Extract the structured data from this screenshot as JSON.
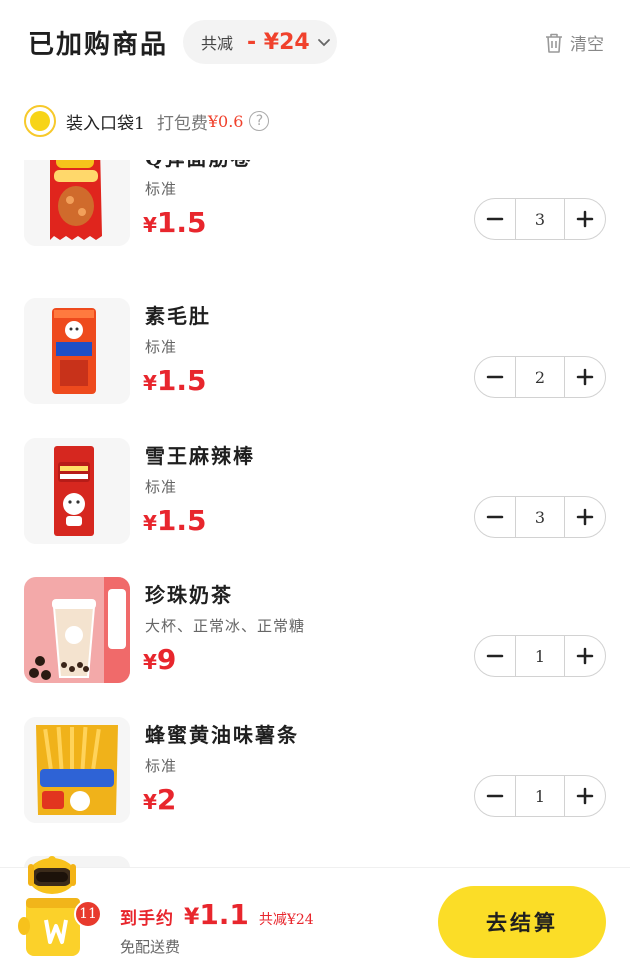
{
  "header": {
    "title": "已加购商品",
    "discount_label": "共减",
    "discount_value": "- ¥24",
    "clear_label": "清空"
  },
  "bag": {
    "label": "装入口袋1",
    "packing_label": "打包费",
    "packing_fee": "¥0.6"
  },
  "items": [
    {
      "name": "Q弹面筋卷",
      "spec": "标准",
      "price_symbol": "¥",
      "price": "1.5",
      "qty": "3",
      "image": "spicy-gluten-roll-pack"
    },
    {
      "name": "素毛肚",
      "spec": "标准",
      "price_symbol": "¥",
      "price": "1.5",
      "qty": "2",
      "image": "veggie-tripe-pack"
    },
    {
      "name": "雪王麻辣棒",
      "spec": "标准",
      "price_symbol": "¥",
      "price": "1.5",
      "qty": "3",
      "image": "spicy-stick-pack"
    },
    {
      "name": "珍珠奶茶",
      "spec": "大杯、正常冰、正常糖",
      "price_symbol": "¥",
      "price": "9",
      "qty": "1",
      "image": "pearl-milk-tea"
    },
    {
      "name": "蜂蜜黄油味薯条",
      "spec": "标准",
      "price_symbol": "¥",
      "price": "2",
      "qty": "1",
      "image": "honey-butter-fries-pack"
    }
  ],
  "footer": {
    "badge_count": "11",
    "pay_label": "到手约",
    "pay_symbol": "¥",
    "pay_amount": "1.1",
    "saved": "共减¥24",
    "free_shipping": "免配送费",
    "checkout_label": "去结算"
  },
  "colors": {
    "accent_red": "#e8262d",
    "accent_yellow": "#fbdd27"
  }
}
